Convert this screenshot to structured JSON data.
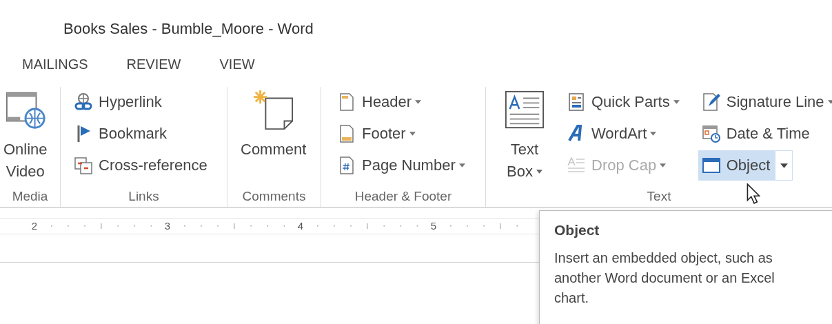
{
  "window": {
    "title": "Books Sales - Bumble_Moore - Word"
  },
  "tabs": [
    {
      "label": "MAILINGS",
      "selected": false
    },
    {
      "label": "REVIEW",
      "selected": false
    },
    {
      "label": "VIEW",
      "selected": false
    }
  ],
  "ribbon": {
    "groups": [
      {
        "label": "Media",
        "columns": [
          [
            {
              "kind": "large",
              "lines": [
                "Online",
                "Video"
              ],
              "dropdown": false,
              "disabled": false,
              "highlighted": false
            }
          ]
        ]
      },
      {
        "label": "Links",
        "columns": [
          [
            {
              "kind": "small",
              "label": "Hyperlink",
              "dropdown": false,
              "disabled": false,
              "highlighted": false
            },
            {
              "kind": "small",
              "label": "Bookmark",
              "dropdown": false,
              "disabled": false,
              "highlighted": false
            },
            {
              "kind": "small",
              "label": "Cross-reference",
              "dropdown": false,
              "disabled": false,
              "highlighted": false
            }
          ]
        ]
      },
      {
        "label": "Comments",
        "columns": [
          [
            {
              "kind": "large",
              "lines": [
                "Comment"
              ],
              "dropdown": false,
              "disabled": false,
              "highlighted": false
            }
          ]
        ]
      },
      {
        "label": "Header & Footer",
        "columns": [
          [
            {
              "kind": "small",
              "label": "Header",
              "dropdown": true,
              "disabled": false,
              "highlighted": false
            },
            {
              "kind": "small",
              "label": "Footer",
              "dropdown": true,
              "disabled": false,
              "highlighted": false
            },
            {
              "kind": "small",
              "label": "Page Number",
              "dropdown": true,
              "disabled": false,
              "highlighted": false
            }
          ]
        ]
      },
      {
        "label": "Text",
        "columns": [
          [
            {
              "kind": "large",
              "lines": [
                "Text",
                "Box"
              ],
              "dropdown": true,
              "disabled": false,
              "highlighted": false
            }
          ],
          [
            {
              "kind": "small",
              "label": "Quick Parts",
              "dropdown": true,
              "disabled": false,
              "highlighted": false
            },
            {
              "kind": "small",
              "label": "WordArt",
              "dropdown": true,
              "disabled": false,
              "highlighted": false
            },
            {
              "kind": "small",
              "label": "Drop Cap",
              "dropdown": true,
              "disabled": true,
              "highlighted": false
            }
          ],
          [
            {
              "kind": "small",
              "label": "Signature Line",
              "dropdown": true,
              "disabled": false,
              "highlighted": false
            },
            {
              "kind": "small",
              "label": "Date & Time",
              "dropdown": false,
              "disabled": false,
              "highlighted": false
            },
            {
              "kind": "split",
              "label": "Object",
              "dropdown": true,
              "disabled": false,
              "highlighted": true
            }
          ]
        ]
      }
    ]
  },
  "ruler": {
    "numbers": [
      "2",
      "3",
      "4",
      "5"
    ]
  },
  "tooltip": {
    "title": "Object",
    "description": "Insert an embedded object, such as another Word document or an Excel chart."
  }
}
